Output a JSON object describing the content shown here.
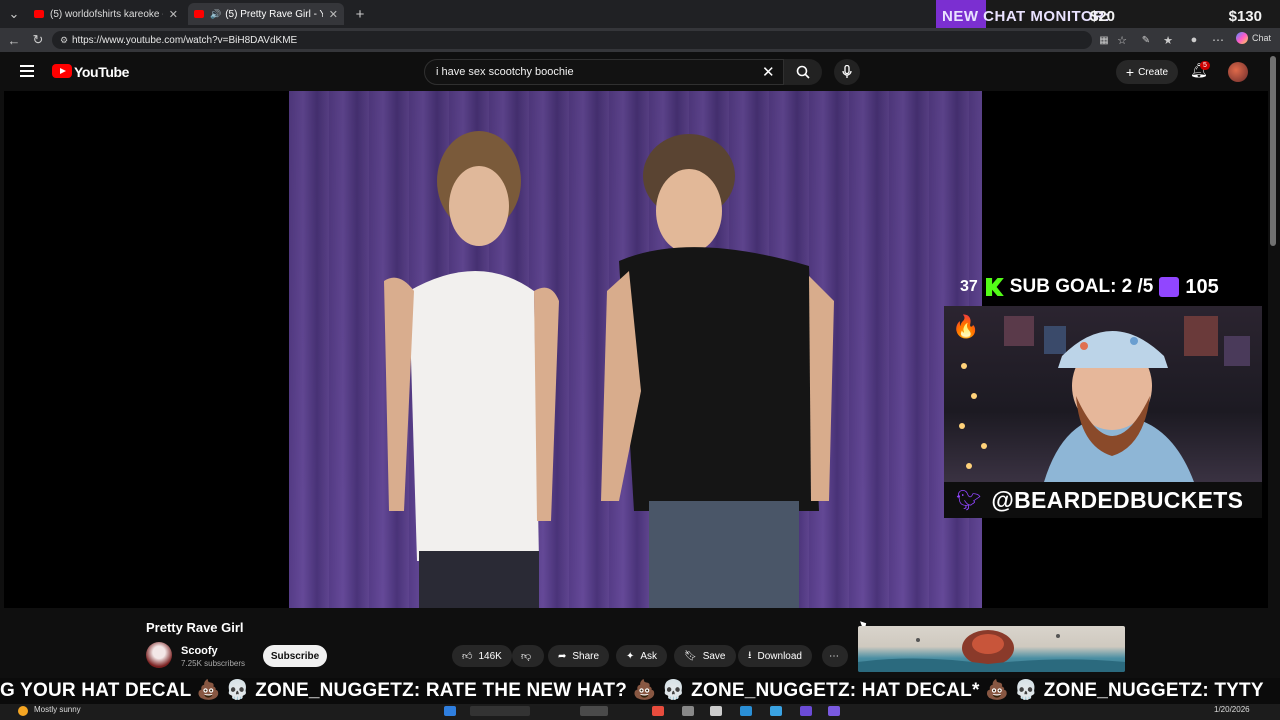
{
  "browser": {
    "tabs": [
      {
        "title": "(5) worldofshirts kareoke - YouTube",
        "active": false
      },
      {
        "title": "(5) Pretty Rave Girl - YouTube",
        "active": true
      }
    ],
    "url": "https://www.youtube.com/watch?v=BiH8DAVdKME",
    "chat_label": "Chat"
  },
  "overlay": {
    "chat_monitor": "NEW CHAT MONITOR:",
    "price1": "$20",
    "price2": "$130",
    "sub_count_left": "37",
    "sub_goal": "SUB GOAL: 2 /5",
    "sub_count_right": "105",
    "twitter_handle": "@BEARDEDBUCKETS",
    "ticker": "G YOUR HAT DECAL 💩 💀 ZONE_NUGGETZ: RATE THE NEW HAT? 💩 💀 ZONE_NUGGETZ: HAT DECAL* 💩 💀 ZONE_NUGGETZ: TYTY"
  },
  "youtube": {
    "logo": "YouTube",
    "search_query": "i have sex scootchy boochie",
    "create_label": "Create",
    "notification_count": "5"
  },
  "video": {
    "title": "Pretty Rave Girl",
    "channel": "Scoofy",
    "subscribers": "7.25K subscribers",
    "subscribe_label": "Subscribe",
    "likes": "146K",
    "share_label": "Share",
    "ask_label": "Ask",
    "save_label": "Save",
    "download_label": "Download"
  },
  "taskbar": {
    "weather": "Mostly sunny",
    "date": "1/20/2026"
  },
  "colors": {
    "youtube_red": "#ff0000",
    "twitch_purple": "#9146ff",
    "kick_green": "#53fc18"
  }
}
